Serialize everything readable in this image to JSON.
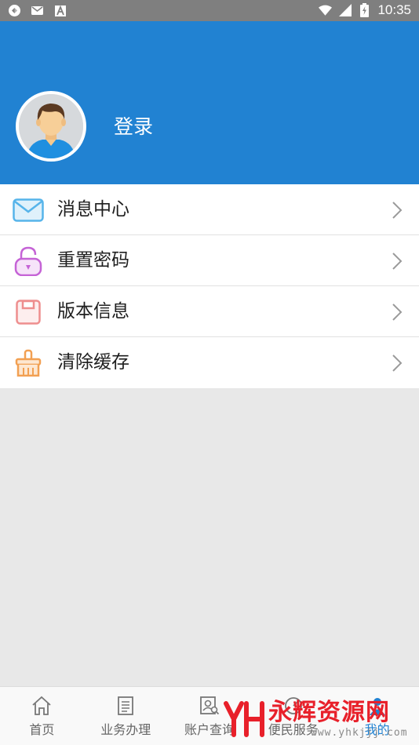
{
  "status_bar": {
    "time": "10:35",
    "icons": [
      "sync-icon",
      "mail-icon",
      "a-icon",
      "wifi-icon",
      "signal-icon",
      "battery-icon"
    ]
  },
  "header": {
    "login_label": "登录",
    "background": "#2182d2"
  },
  "menu": {
    "items": [
      {
        "label": "消息中心",
        "icon": "envelope-icon"
      },
      {
        "label": "重置密码",
        "icon": "lock-icon"
      },
      {
        "label": "版本信息",
        "icon": "floppy-icon"
      },
      {
        "label": "清除缓存",
        "icon": "broom-icon"
      }
    ]
  },
  "tabbar": {
    "tabs": [
      {
        "label": "首页",
        "icon": "home-icon",
        "active": false
      },
      {
        "label": "业务办理",
        "icon": "document-icon",
        "active": false
      },
      {
        "label": "账户查询",
        "icon": "account-search-icon",
        "active": false
      },
      {
        "label": "便民服务",
        "icon": "service-icon",
        "active": false
      },
      {
        "label": "我的",
        "icon": "person-icon",
        "active": true
      }
    ]
  },
  "watermark": {
    "text": "永辉资源网",
    "url": "www.yhkjjj.com"
  }
}
